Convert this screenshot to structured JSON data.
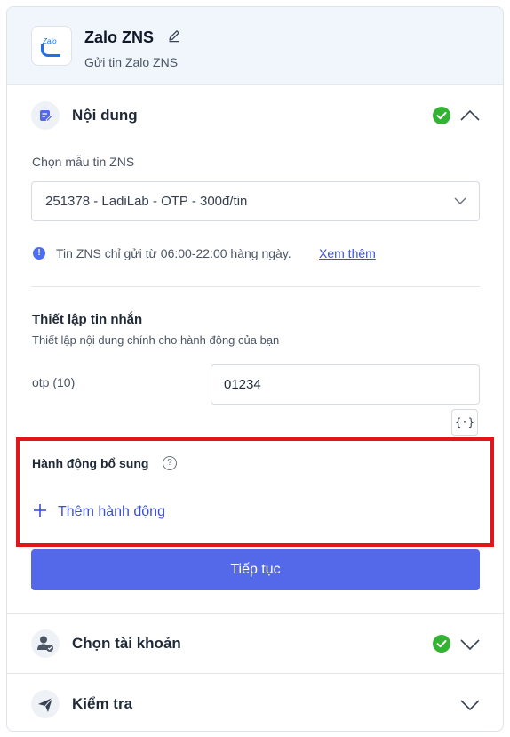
{
  "header": {
    "title": "Zalo ZNS",
    "subtitle": "Gửi tin Zalo ZNS",
    "logo_text": "Zalo"
  },
  "sections": {
    "content": {
      "title": "Nội dung",
      "status": "completed",
      "expanded": true
    },
    "account": {
      "title": "Chọn tài khoản",
      "status": "completed",
      "expanded": false
    },
    "check": {
      "title": "Kiểm tra",
      "expanded": false
    }
  },
  "template": {
    "label": "Chọn mẫu tin ZNS",
    "selected": "251378 - LadiLab - OTP - 300đ/tin"
  },
  "notice": {
    "text": "Tin ZNS chỉ gửi từ 06:00-22:00 hàng ngày.",
    "link": "Xem thêm"
  },
  "message_setup": {
    "title": "Thiết lập tin nhắn",
    "description": "Thiết lập nội dung chính cho hành động của bạn",
    "otp_label": "otp (10)",
    "otp_value": "01234",
    "variable_button": "{·}"
  },
  "extra_actions": {
    "title": "Hành động bổ sung",
    "help": "?",
    "add_label": "Thêm hành động"
  },
  "continue_label": "Tiếp tục",
  "colors": {
    "primary": "#5469ea",
    "link": "#3b4fd8",
    "success": "#34b233",
    "highlight": "#e4141b",
    "header_bg": "#f1f6fd"
  },
  "icons": {
    "edit": "pencil-icon",
    "content": "note-edit-icon",
    "account": "user-check-icon",
    "check": "send-icon",
    "info": "info-icon",
    "help": "question-icon",
    "add": "plus-icon"
  }
}
